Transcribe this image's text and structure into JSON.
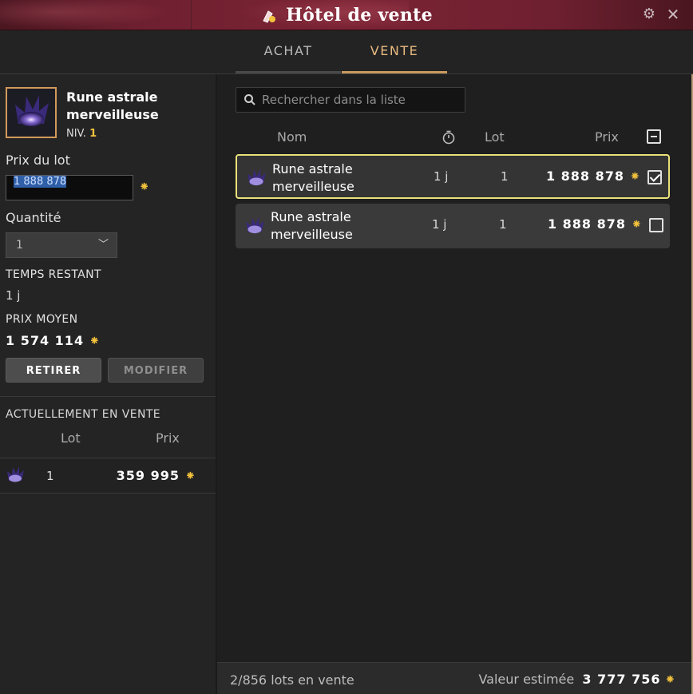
{
  "window": {
    "title": "Hôtel de vente"
  },
  "tabs": [
    {
      "label": "ACHAT"
    },
    {
      "label": "VENTE"
    }
  ],
  "item": {
    "name": "Rune astrale merveilleuse",
    "level_label": "NIV.",
    "level": "1"
  },
  "form": {
    "price_label": "Prix du lot",
    "price_value": "1 888 878",
    "quantity_label": "Quantité",
    "quantity_value": "1",
    "time_left_label": "TEMPS RESTANT",
    "time_left_value": "1 j",
    "avg_price_label": "PRIX MOYEN",
    "avg_price_value": "1 574 114",
    "remove_button": "RETIRER",
    "modify_button": "MODIFIER"
  },
  "current_sales": {
    "heading": "ACTUELLEMENT EN VENTE",
    "columns": [
      "Lot",
      "Prix"
    ],
    "rows": [
      {
        "lot": "1",
        "price": "359 995"
      }
    ]
  },
  "list": {
    "search_placeholder": "Rechercher dans la liste",
    "columns": {
      "name": "Nom",
      "lot": "Lot",
      "price": "Prix"
    },
    "rows": [
      {
        "name": "Rune astrale merveilleuse",
        "time": "1 j",
        "lot": "1",
        "price": "1 888 878",
        "checked": true
      },
      {
        "name": "Rune astrale merveilleuse",
        "time": "1 j",
        "lot": "1",
        "price": "1 888 878",
        "checked": false
      }
    ]
  },
  "footer": {
    "lots_text": "2/856 lots en vente",
    "estimate_label": "Valeur estimée",
    "estimate_value": "3 777 756"
  },
  "colors": {
    "accent": "#e8b980",
    "kama": "#f2c23c",
    "selected_border": "#e9e17a"
  },
  "icons": [
    "auction-icon",
    "gear-icon",
    "close-icon",
    "rune-icon",
    "kama-icon",
    "chevron-down-icon",
    "search-icon",
    "timer-icon"
  ]
}
